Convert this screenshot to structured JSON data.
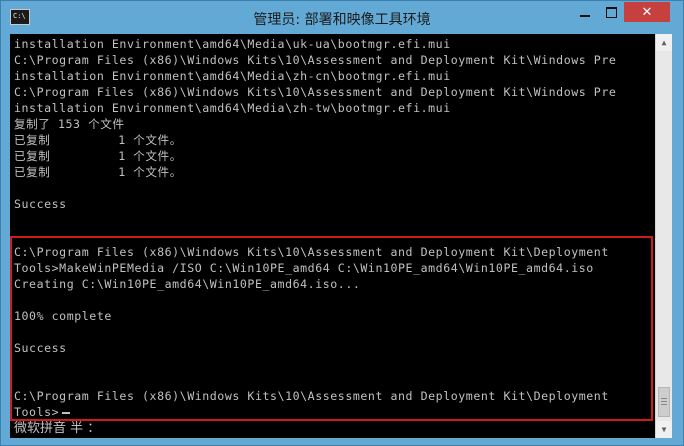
{
  "window": {
    "title": "管理员: 部署和映像工具环境",
    "icon_label": "C:\\"
  },
  "console": {
    "lines": [
      "installation Environment\\amd64\\Media\\uk-ua\\bootmgr.efi.mui",
      "C:\\Program Files (x86)\\Windows Kits\\10\\Assessment and Deployment Kit\\Windows Pre",
      "installation Environment\\amd64\\Media\\zh-cn\\bootmgr.efi.mui",
      "C:\\Program Files (x86)\\Windows Kits\\10\\Assessment and Deployment Kit\\Windows Pre",
      "installation Environment\\amd64\\Media\\zh-tw\\bootmgr.efi.mui",
      "复制了 153 个文件",
      "已复制         1 个文件。",
      "已复制         1 个文件。",
      "已复制         1 个文件。",
      "",
      "Success",
      "",
      "",
      "C:\\Program Files (x86)\\Windows Kits\\10\\Assessment and Deployment Kit\\Deployment",
      "Tools>MakeWinPEMedia /ISO C:\\Win10PE_amd64 C:\\Win10PE_amd64\\Win10PE_amd64.iso",
      "Creating C:\\Win10PE_amd64\\Win10PE_amd64.iso...",
      "",
      "100% complete",
      "",
      "Success",
      "",
      "",
      "C:\\Program Files (x86)\\Windows Kits\\10\\Assessment and Deployment Kit\\Deployment",
      "Tools>"
    ]
  },
  "ime_status": "微软拼音 半 ：",
  "colors": {
    "titlebar": "#62a9d6",
    "console_bg": "#000000",
    "console_text": "#c0c0c0",
    "highlight": "#d11a1a",
    "close_button": "#c74040"
  }
}
